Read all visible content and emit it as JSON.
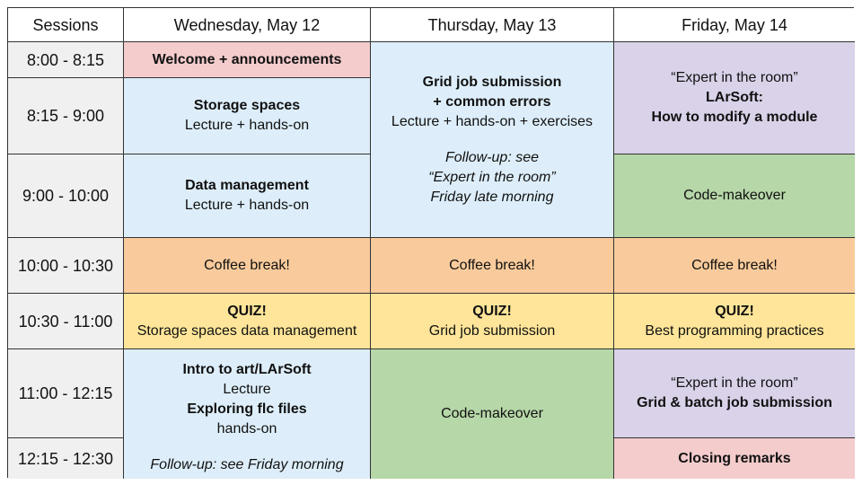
{
  "header": {
    "sessions": "Sessions",
    "wed": "Wednesday, May 12",
    "thu": "Thursday, May 13",
    "fri": "Friday, May 14"
  },
  "times": [
    "8:00 - 8:15",
    "8:15 - 9:00",
    "9:00 - 10:00",
    "10:00 - 10:30",
    "10:30 - 11:00",
    "11:00 - 12:15",
    "12:15 - 12:30"
  ],
  "wed": {
    "welcome": "Welcome + announcements",
    "storage_title": "Storage spaces",
    "storage_sub": "Lecture + hands-on",
    "data_title": "Data management",
    "data_sub": "Lecture + hands-on",
    "coffee": "Coffee break!",
    "quiz_title": "QUIZ!",
    "quiz_sub": "Storage spaces data management",
    "art_title": "Intro to art/LArSoft",
    "art_sub": "Lecture",
    "flc_title": "Exploring flc files",
    "flc_sub": "hands-on",
    "followup": "Follow-up: see Friday morning"
  },
  "thu": {
    "grid_title1": "Grid job submission",
    "grid_title2": "+ common errors",
    "grid_sub": "Lecture + hands-on + exercises",
    "followup1": "Follow-up: see",
    "followup2": "“Expert in the room”",
    "followup3": "Friday late morning",
    "coffee": "Coffee break!",
    "quiz_title": "QUIZ!",
    "quiz_sub": "Grid job submission",
    "makeover": "Code-makeover"
  },
  "fri": {
    "expert1": "“Expert in the room”",
    "larsoft_title": "LArSoft:",
    "larsoft_sub": "How to modify a module",
    "makeover": "Code-makeover",
    "coffee": "Coffee break!",
    "quiz_title": "QUIZ!",
    "quiz_sub": "Best programming practices",
    "expert2": "“Expert in the room”",
    "grid_batch": "Grid & batch job submission",
    "closing": "Closing remarks"
  },
  "colors": {
    "pink": "#f4cccc",
    "blue": "#ddeefa",
    "purple": "#d9d2e9",
    "green": "#b6d7a8",
    "orange": "#f9cb9c",
    "yellow": "#ffe599",
    "time": "#f0f0f0"
  }
}
